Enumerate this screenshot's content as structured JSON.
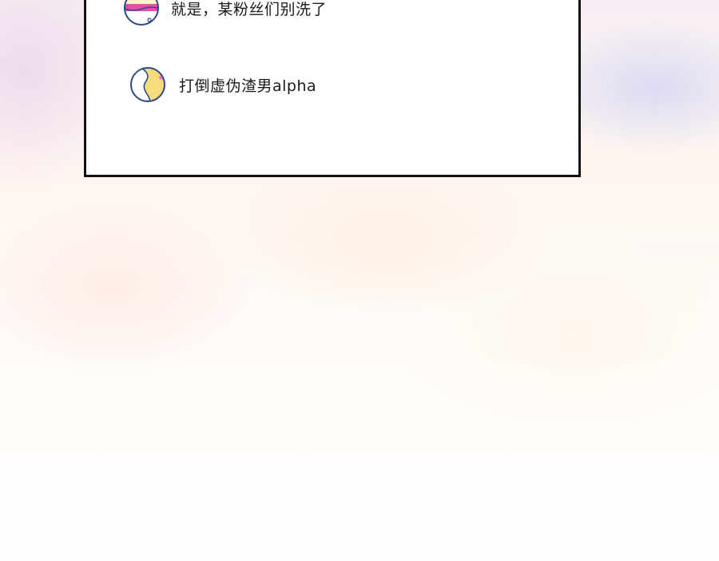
{
  "comments": [
    {
      "avatar": "striped-pink-avatar-icon",
      "text": "就是，某粉丝们别洗了"
    },
    {
      "avatar": "yellow-white-avatar-icon",
      "text": "打倒虚伪渣男alpha"
    }
  ],
  "colors": {
    "panel_border": "#111111",
    "panel_background": "#ffffff",
    "avatar_outline": "#2f4a8a",
    "avatar_pink": "#e64fa8",
    "avatar_purple": "#8e6bd8",
    "avatar_yellow": "#f7dc7d"
  }
}
